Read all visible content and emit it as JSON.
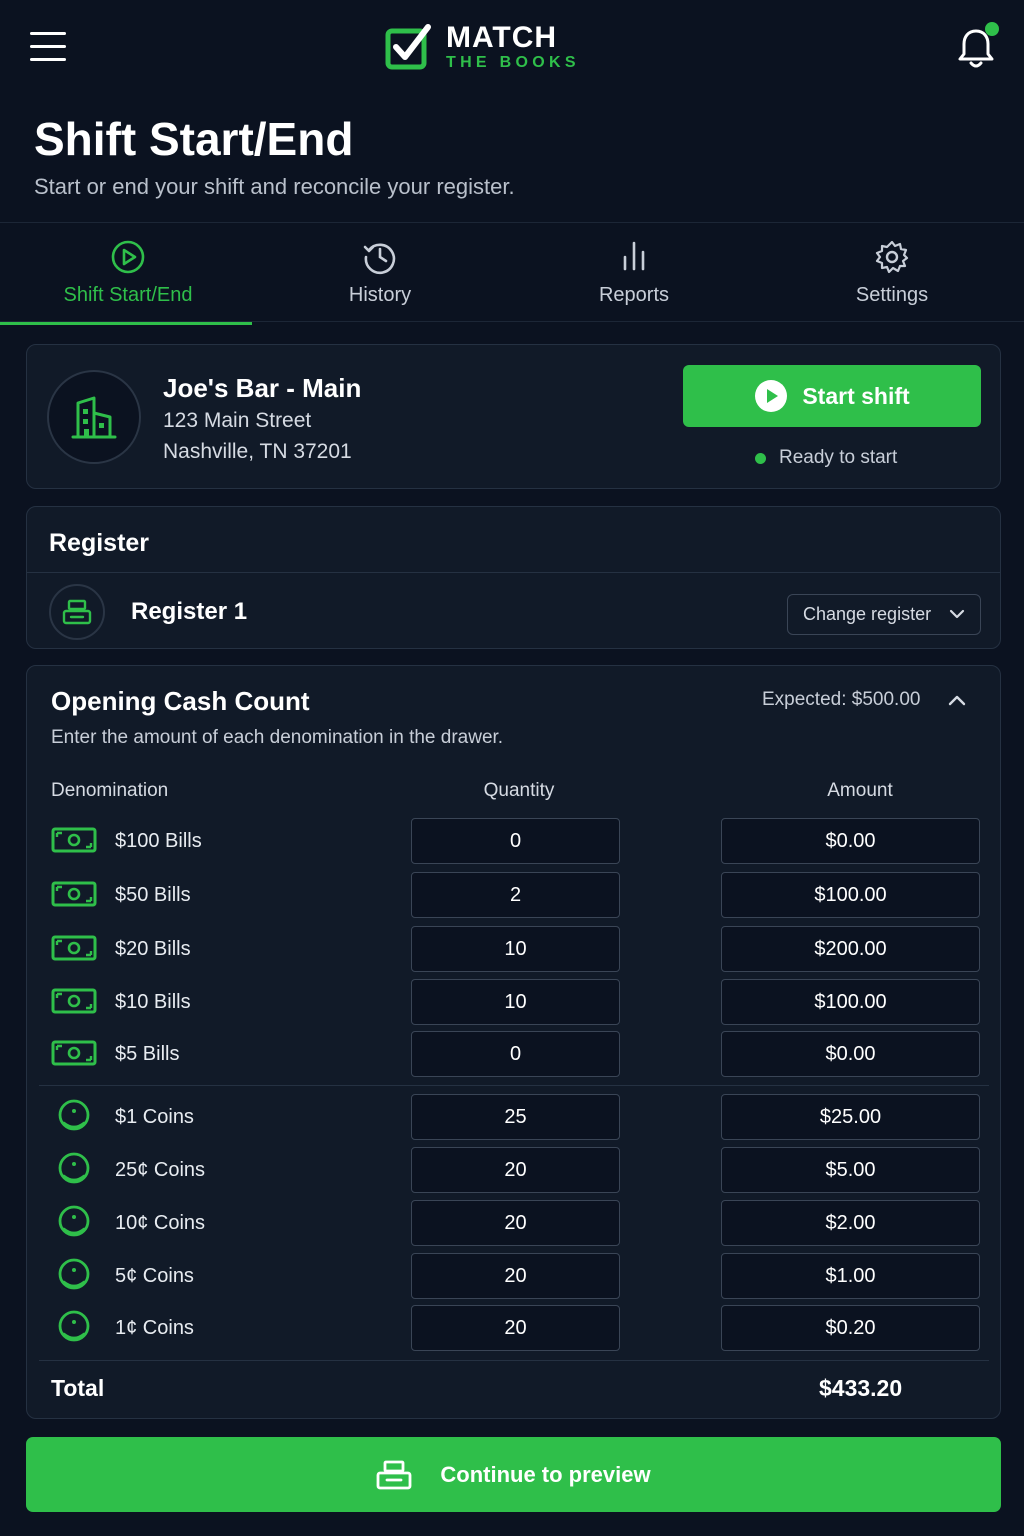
{
  "header": {
    "logo_main": "MATCH",
    "logo_sub": "THE BOOKS",
    "icons": {
      "menu": "hamburger-menu-icon",
      "notifications": "bell-icon",
      "logo": "checkbox-logo-icon"
    },
    "notification_dot_color": "#2fbf4a"
  },
  "page": {
    "title": "Shift Start/End",
    "subtitle": "Start or end your shift and reconcile your register."
  },
  "tabs": [
    {
      "label": "Shift Start/End",
      "icon": "play-circle-icon",
      "active": true
    },
    {
      "label": "History",
      "icon": "history-icon",
      "active": false
    },
    {
      "label": "Reports",
      "icon": "bar-chart-icon",
      "active": false
    },
    {
      "label": "Settings",
      "icon": "gear-icon",
      "active": false
    }
  ],
  "location": {
    "name": "Joe's Bar - Main",
    "address_line1": "123 Main Street",
    "address_line2": "Nashville, TN 37201",
    "icon": "building-icon",
    "start_button": "Start shift",
    "status": "Ready to start"
  },
  "register": {
    "heading": "Register",
    "name": "Register 1",
    "icon": "cash-register-icon",
    "change_button": "Change register"
  },
  "cash_count": {
    "title": "Opening Cash Count",
    "subtitle": "Enter the amount of each denomination in the drawer.",
    "expected": "Expected: $500.00",
    "columns": {
      "denomination": "Denomination",
      "quantity": "Quantity",
      "amount": "Amount"
    },
    "rows": [
      {
        "label": "$100 Bills",
        "quantity": "0",
        "amount": "$0.00",
        "icon": "bill-icon"
      },
      {
        "label": "$50 Bills",
        "quantity": "2",
        "amount": "$100.00",
        "icon": "bill-icon"
      },
      {
        "label": "$20 Bills",
        "quantity": "10",
        "amount": "$200.00",
        "icon": "bill-icon"
      },
      {
        "label": "$10 Bills",
        "quantity": "10",
        "amount": "$100.00",
        "icon": "bill-icon"
      },
      {
        "label": "$5 Bills",
        "quantity": "0",
        "amount": "$0.00",
        "icon": "bill-icon"
      },
      {
        "label": "$1 Coins",
        "quantity": "25",
        "amount": "$25.00",
        "icon": "coin-icon"
      },
      {
        "label": "25¢ Coins",
        "quantity": "20",
        "amount": "$5.00",
        "icon": "coin-icon"
      },
      {
        "label": "10¢ Coins",
        "quantity": "20",
        "amount": "$2.00",
        "icon": "coin-icon"
      },
      {
        "label": "5¢ Coins",
        "quantity": "20",
        "amount": "$1.00",
        "icon": "coin-icon"
      },
      {
        "label": "1¢ Coins",
        "quantity": "20",
        "amount": "$0.20",
        "icon": "coin-icon"
      }
    ],
    "total_label": "Total",
    "total_value": "$433.20"
  },
  "cta": {
    "label": "Continue to preview",
    "icon": "cash-register-icon"
  },
  "colors": {
    "accent": "#2fbf4a",
    "background": "#0b1220",
    "card": "#111a28"
  }
}
